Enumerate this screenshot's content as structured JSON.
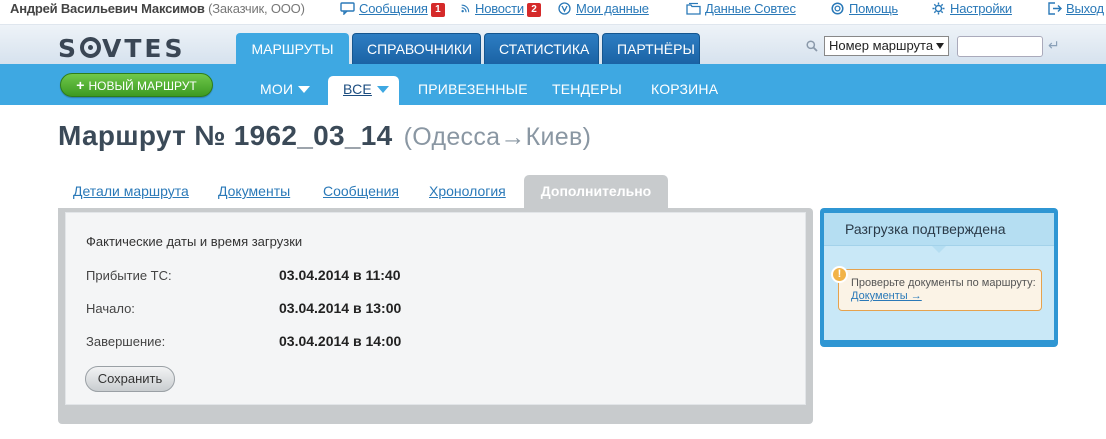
{
  "user": {
    "name": "Андрей Васильевич Максимов",
    "role": "(Заказчик, ООО)"
  },
  "toplinks": {
    "messages": {
      "label": "Сообщения",
      "count": "1"
    },
    "news": {
      "label": "Новости",
      "count": "2"
    },
    "mydata": "Мои данные",
    "sovtes": "Данные Совтес",
    "help": "Помощь",
    "settings": "Настройки",
    "exit": "Выход"
  },
  "logo": {
    "left": "S",
    "right": "VTES"
  },
  "main_tabs": [
    "МАРШРУТЫ",
    "СПРАВОЧНИКИ",
    "СТАТИСТИКА",
    "ПАРТНЁРЫ"
  ],
  "search": {
    "select_value": "Номер маршрута",
    "enter_symbol": "↵"
  },
  "new_route_label": "НОВЫЙ МАРШРУТ",
  "sub_tabs": {
    "my": "МОИ",
    "all": "ВСЕ",
    "brought": "ПРИВЕЗЕННЫЕ",
    "tenders": "ТЕНДЕРЫ",
    "basket": "КОРЗИНА"
  },
  "page": {
    "title": "Маршрут № 1962_03_14",
    "route": "(Одесса→Киев)"
  },
  "route_tabs": [
    "Детали маршрута",
    "Документы",
    "Сообщения",
    "Хронология",
    "Дополнительно"
  ],
  "loading": {
    "heading": "Фактические даты и время загрузки",
    "rows": [
      {
        "label": "Прибытие ТС:",
        "value": "03.04.2014 в 11:40"
      },
      {
        "label": "Начало:",
        "value": "03.04.2014 в 13:00"
      },
      {
        "label": "Завершение:",
        "value": "03.04.2014 в 14:00"
      }
    ],
    "save_label": "Сохранить"
  },
  "status": {
    "title": "Разгрузка подтверждена",
    "warn_icon": "!",
    "warn_text": "Проверьте документы по маршруту:",
    "warn_link": "Документы →"
  },
  "colors": {
    "primary": "#3ea8e2",
    "tab_dark": "#1a62a4",
    "new_button": "#4caf2e",
    "badge": "#d52a2a",
    "warning_border": "#e6a24d"
  }
}
